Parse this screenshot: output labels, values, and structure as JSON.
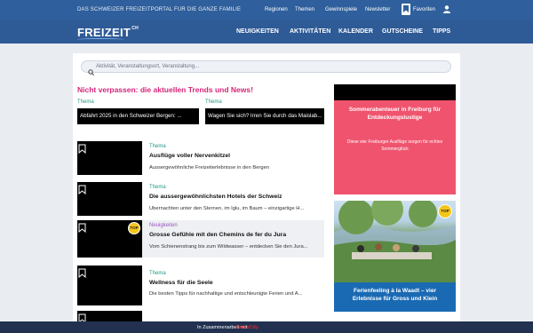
{
  "topbar": {
    "tagline": "DAS SCHWEIZER FREIZEITPORTAL FÜR DIE GANZE FAMILIE",
    "links": [
      "Regionen",
      "Themen",
      "Gewinnspiele",
      "Newsletter"
    ],
    "favorites": "Favoriten"
  },
  "logo": {
    "text": "FREIZEIT",
    "suffix": "CH"
  },
  "nav": [
    "NEUIGKEITEN",
    "AKTIVITÄTEN",
    "KALENDER",
    "GUTSCHEINE",
    "TIPPS"
  ],
  "search": {
    "placeholder": "Aktivität, Veranstaltungsort, Veranstaltung..."
  },
  "main": {
    "heading": "Nicht verpassen: die aktuellen Trends und News!",
    "trends": [
      {
        "label": "Thema",
        "title": "Abfahrt 2025 in den Schweizer Bergen: ..."
      },
      {
        "label": "Thema",
        "title": "Wagen Sie sich? Irren Sie durch das Maislab..."
      }
    ],
    "articles": [
      {
        "category": "Thema",
        "title": "Ausflüge voller Nervenkitzel",
        "desc": "Aussergewöhnliche Freizeiterlebnisse in den Bergen"
      },
      {
        "category": "Thema",
        "title": "Die aussergewöhnlichsten Hotels der Schweiz",
        "desc": "Übernachten unter den Sternen, im Iglu, im Baum – einzigartige H..."
      },
      {
        "category": "Neuigkeiten",
        "title": "Grosse Gefühle mit den Chemins de fer du Jura",
        "desc": "Vom Schienenstrang bis zum Wildwasser – entdecken Sie den Jura...",
        "badge": "TOP"
      },
      {
        "category": "Thema",
        "title": "Wellness für die Seele",
        "desc": "Die besten Tipps für nachhaltige und entschleunigte Ferien und A..."
      },
      {
        "category": "",
        "title": "",
        "desc": ""
      }
    ]
  },
  "sidebar": {
    "ad1": {
      "title": "Sommerabenteuer in Freiburg für Entdeckungslustige",
      "subtitle": "Diese vier Freiburger Ausflüge sorgen für echtes Sommerglück"
    },
    "ad2": {
      "badge": "TOP",
      "title": "Ferienfeeling à la Waadt – vier Erlebnisse für Gross und Klein"
    }
  },
  "footer": {
    "text": "In Zusammenarbeit mit",
    "brand": "SwissCity"
  },
  "colors": {
    "accent": "#d6257a",
    "nav": "#2e5a96",
    "theme_label": "#1f9a84"
  }
}
